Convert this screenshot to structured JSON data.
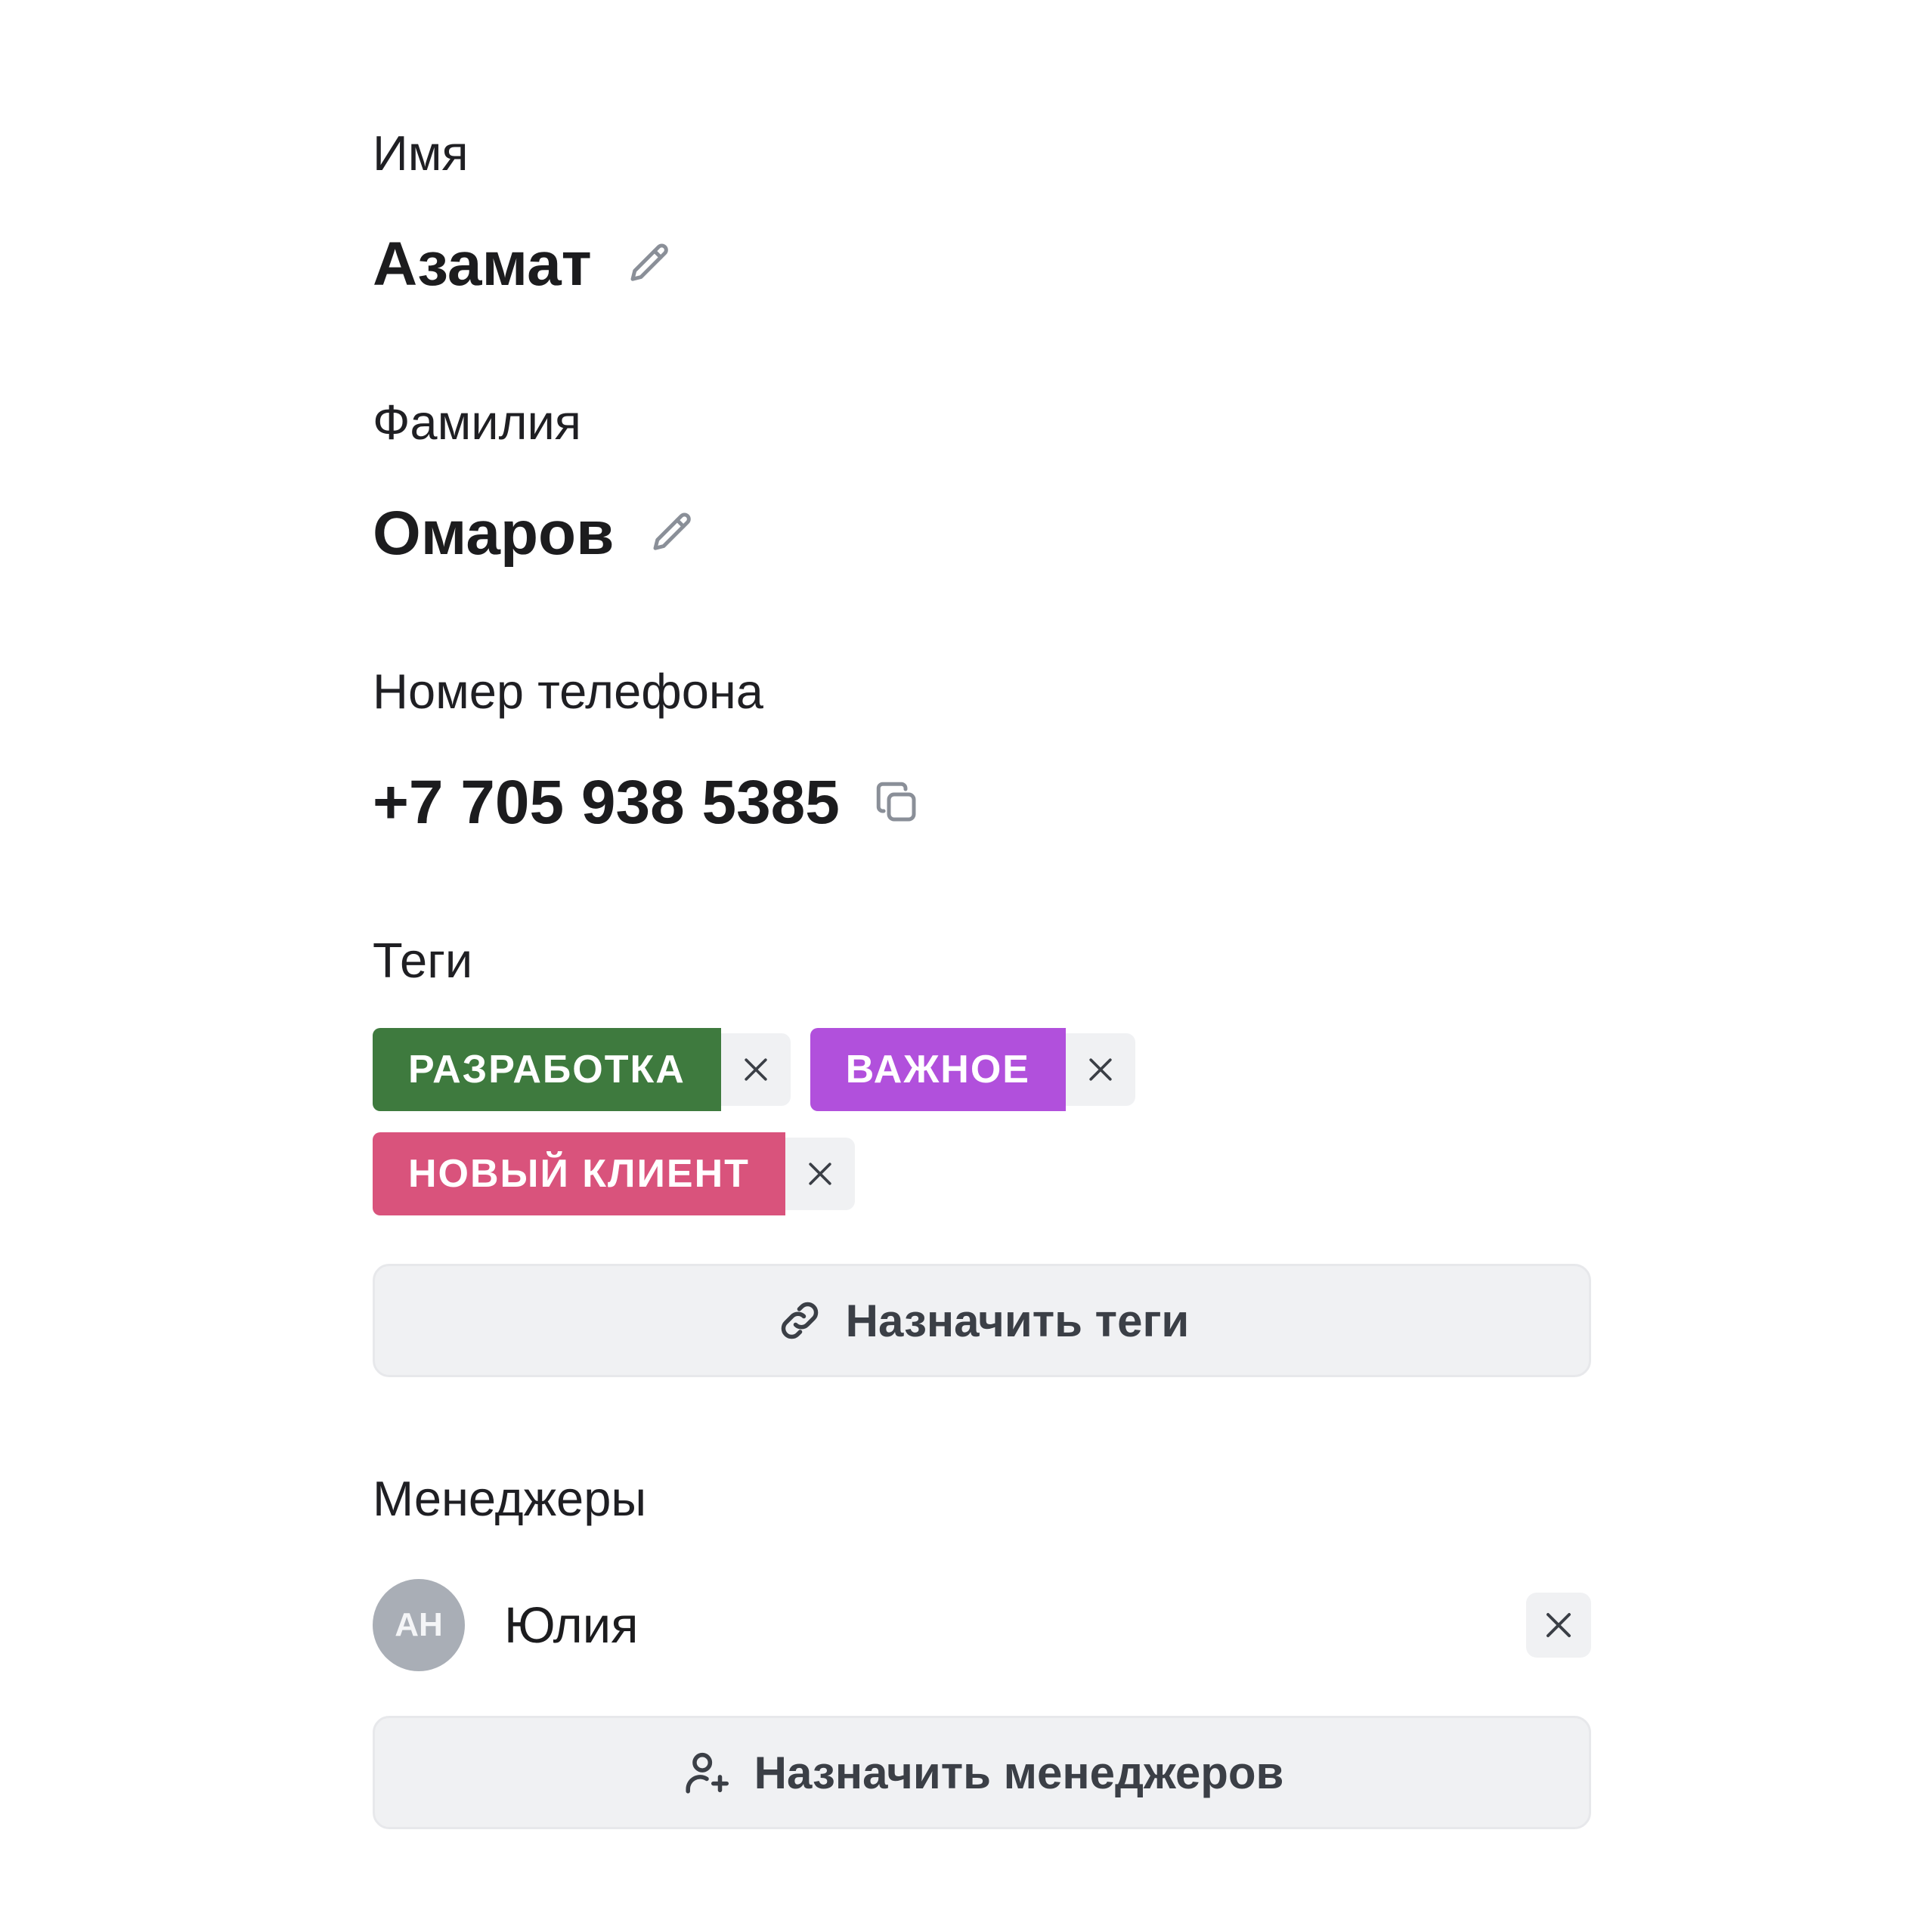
{
  "fields": {
    "first_name": {
      "label": "Имя",
      "value": "Азамат",
      "action_icon": "pencil-icon"
    },
    "last_name": {
      "label": "Фамилия",
      "value": "Омаров",
      "action_icon": "pencil-icon"
    },
    "phone": {
      "label": "Номер телефона",
      "value": "+7 705 938 5385",
      "action_icon": "copy-icon"
    }
  },
  "tags": {
    "label": "Теги",
    "items": [
      {
        "label": "РАЗРАБОТКА",
        "color": "#3e7a3e"
      },
      {
        "label": "ВАЖНОЕ",
        "color": "#b150dc"
      },
      {
        "label": "НОВЫЙ КЛИЕНТ",
        "color": "#d9537c"
      }
    ],
    "remove_icon": "close-icon",
    "assign_button": {
      "label": "Назначить теги",
      "icon": "link-icon"
    }
  },
  "managers": {
    "label": "Менеджеры",
    "items": [
      {
        "initials": "АН",
        "name": "Юлия"
      }
    ],
    "remove_icon": "close-icon",
    "assign_button": {
      "label": "Назначить менеджеров",
      "icon": "add-user-icon"
    }
  },
  "colors": {
    "button_bg": "#f0f1f3",
    "avatar_bg": "#a9aeb6",
    "icon_gray": "#8a8f98",
    "text_dark": "#1c1c1e"
  }
}
